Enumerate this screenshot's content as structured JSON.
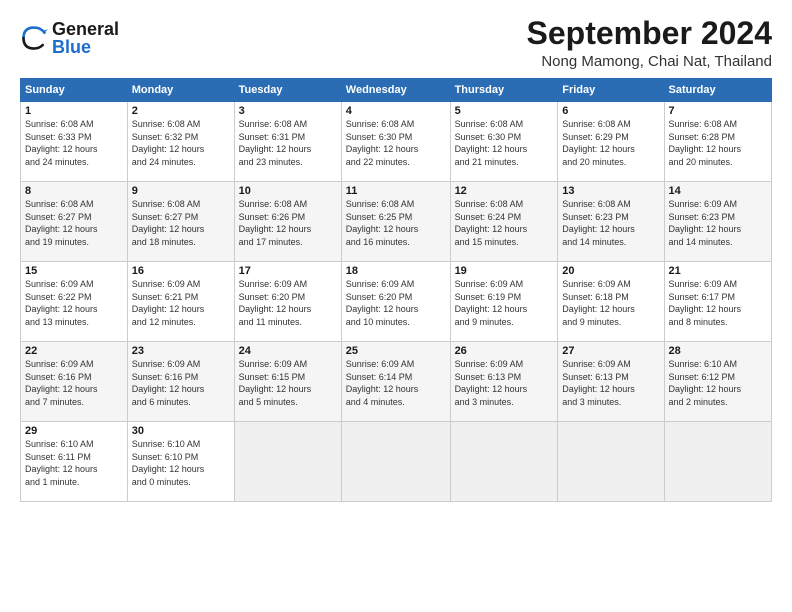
{
  "header": {
    "logo_text_general": "General",
    "logo_text_blue": "Blue",
    "month_title": "September 2024",
    "location": "Nong Mamong, Chai Nat, Thailand"
  },
  "weekdays": [
    "Sunday",
    "Monday",
    "Tuesday",
    "Wednesday",
    "Thursday",
    "Friday",
    "Saturday"
  ],
  "weeks": [
    [
      {
        "day": "1",
        "sunrise": "6:08 AM",
        "sunset": "6:33 PM",
        "daylight": "12 hours and 24 minutes."
      },
      {
        "day": "2",
        "sunrise": "6:08 AM",
        "sunset": "6:32 PM",
        "daylight": "12 hours and 24 minutes."
      },
      {
        "day": "3",
        "sunrise": "6:08 AM",
        "sunset": "6:31 PM",
        "daylight": "12 hours and 23 minutes."
      },
      {
        "day": "4",
        "sunrise": "6:08 AM",
        "sunset": "6:30 PM",
        "daylight": "12 hours and 22 minutes."
      },
      {
        "day": "5",
        "sunrise": "6:08 AM",
        "sunset": "6:30 PM",
        "daylight": "12 hours and 21 minutes."
      },
      {
        "day": "6",
        "sunrise": "6:08 AM",
        "sunset": "6:29 PM",
        "daylight": "12 hours and 20 minutes."
      },
      {
        "day": "7",
        "sunrise": "6:08 AM",
        "sunset": "6:28 PM",
        "daylight": "12 hours and 20 minutes."
      }
    ],
    [
      {
        "day": "8",
        "sunrise": "6:08 AM",
        "sunset": "6:27 PM",
        "daylight": "12 hours and 19 minutes."
      },
      {
        "day": "9",
        "sunrise": "6:08 AM",
        "sunset": "6:27 PM",
        "daylight": "12 hours and 18 minutes."
      },
      {
        "day": "10",
        "sunrise": "6:08 AM",
        "sunset": "6:26 PM",
        "daylight": "12 hours and 17 minutes."
      },
      {
        "day": "11",
        "sunrise": "6:08 AM",
        "sunset": "6:25 PM",
        "daylight": "12 hours and 16 minutes."
      },
      {
        "day": "12",
        "sunrise": "6:08 AM",
        "sunset": "6:24 PM",
        "daylight": "12 hours and 15 minutes."
      },
      {
        "day": "13",
        "sunrise": "6:08 AM",
        "sunset": "6:23 PM",
        "daylight": "12 hours and 14 minutes."
      },
      {
        "day": "14",
        "sunrise": "6:09 AM",
        "sunset": "6:23 PM",
        "daylight": "12 hours and 14 minutes."
      }
    ],
    [
      {
        "day": "15",
        "sunrise": "6:09 AM",
        "sunset": "6:22 PM",
        "daylight": "12 hours and 13 minutes."
      },
      {
        "day": "16",
        "sunrise": "6:09 AM",
        "sunset": "6:21 PM",
        "daylight": "12 hours and 12 minutes."
      },
      {
        "day": "17",
        "sunrise": "6:09 AM",
        "sunset": "6:20 PM",
        "daylight": "12 hours and 11 minutes."
      },
      {
        "day": "18",
        "sunrise": "6:09 AM",
        "sunset": "6:20 PM",
        "daylight": "12 hours and 10 minutes."
      },
      {
        "day": "19",
        "sunrise": "6:09 AM",
        "sunset": "6:19 PM",
        "daylight": "12 hours and 9 minutes."
      },
      {
        "day": "20",
        "sunrise": "6:09 AM",
        "sunset": "6:18 PM",
        "daylight": "12 hours and 9 minutes."
      },
      {
        "day": "21",
        "sunrise": "6:09 AM",
        "sunset": "6:17 PM",
        "daylight": "12 hours and 8 minutes."
      }
    ],
    [
      {
        "day": "22",
        "sunrise": "6:09 AM",
        "sunset": "6:16 PM",
        "daylight": "12 hours and 7 minutes."
      },
      {
        "day": "23",
        "sunrise": "6:09 AM",
        "sunset": "6:16 PM",
        "daylight": "12 hours and 6 minutes."
      },
      {
        "day": "24",
        "sunrise": "6:09 AM",
        "sunset": "6:15 PM",
        "daylight": "12 hours and 5 minutes."
      },
      {
        "day": "25",
        "sunrise": "6:09 AM",
        "sunset": "6:14 PM",
        "daylight": "12 hours and 4 minutes."
      },
      {
        "day": "26",
        "sunrise": "6:09 AM",
        "sunset": "6:13 PM",
        "daylight": "12 hours and 3 minutes."
      },
      {
        "day": "27",
        "sunrise": "6:09 AM",
        "sunset": "6:13 PM",
        "daylight": "12 hours and 3 minutes."
      },
      {
        "day": "28",
        "sunrise": "6:10 AM",
        "sunset": "6:12 PM",
        "daylight": "12 hours and 2 minutes."
      }
    ],
    [
      {
        "day": "29",
        "sunrise": "6:10 AM",
        "sunset": "6:11 PM",
        "daylight": "12 hours and 1 minute."
      },
      {
        "day": "30",
        "sunrise": "6:10 AM",
        "sunset": "6:10 PM",
        "daylight": "12 hours and 0 minutes."
      },
      null,
      null,
      null,
      null,
      null
    ]
  ]
}
